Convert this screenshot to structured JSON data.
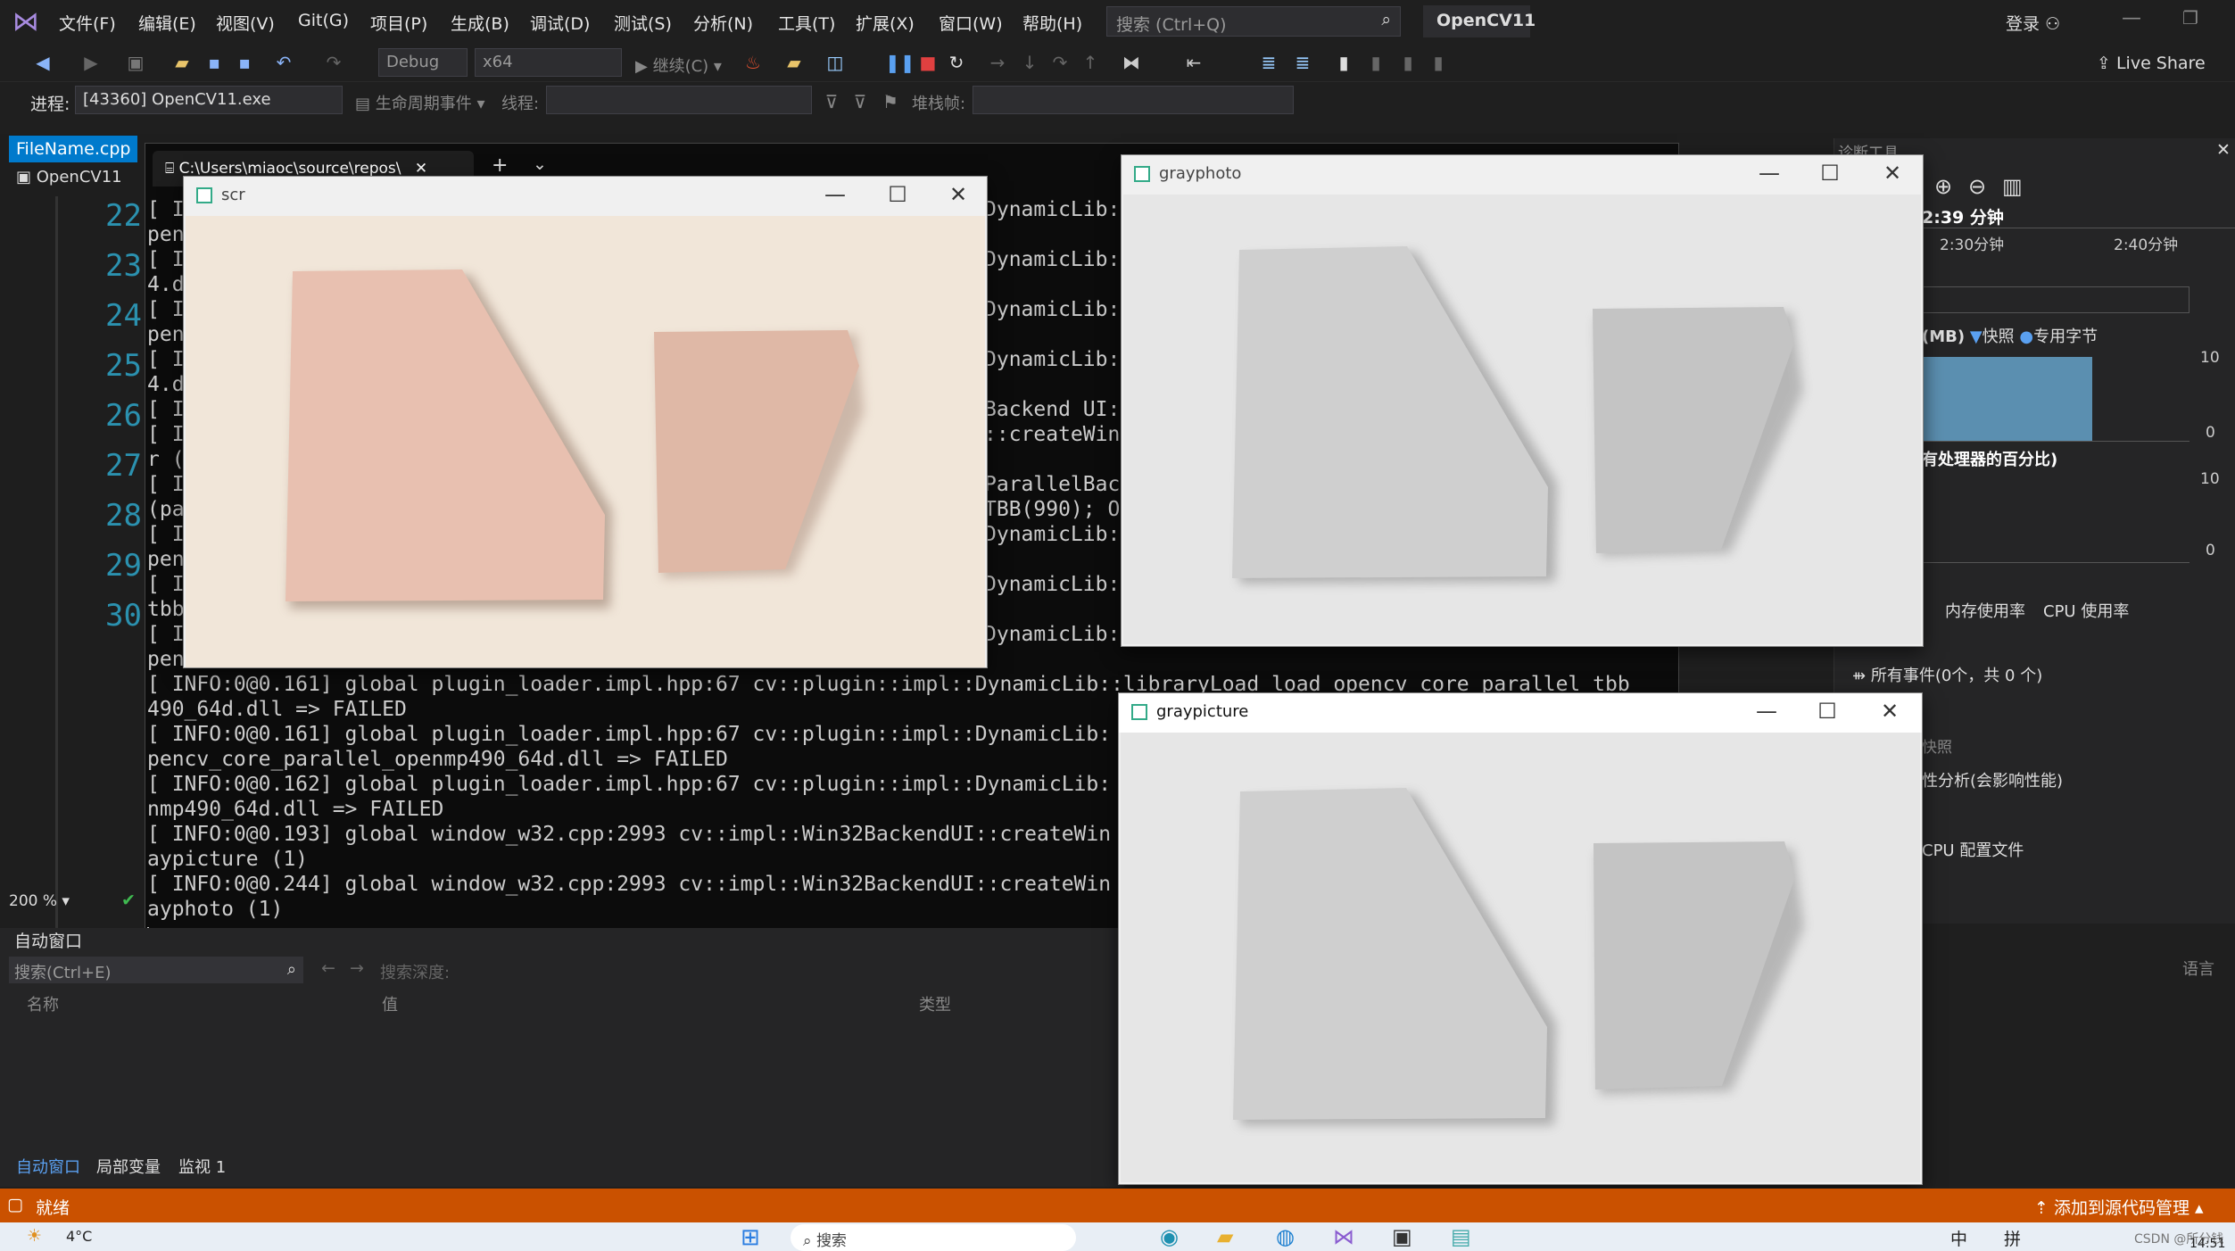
{
  "menu": [
    "文件(F)",
    "编辑(E)",
    "视图(V)",
    "Git(G)",
    "项目(P)",
    "生成(B)",
    "调试(D)",
    "测试(S)",
    "分析(N)",
    "工具(T)",
    "扩展(X)",
    "窗口(W)",
    "帮助(H)"
  ],
  "search_placeholder": "搜索 (Ctrl+Q)",
  "project_name": "OpenCV11",
  "login": "登录",
  "live_share": "Live Share",
  "toolbar": {
    "config": "Debug",
    "platform": "x64",
    "continue": "继续(C)"
  },
  "process": {
    "label": "进程:",
    "value": "[43360] OpenCV11.exe",
    "lifecycle": "生命周期事件",
    "thread_label": "线程:",
    "stack_label": "堆栈帧:"
  },
  "tabs": {
    "file": "FileName.cpp",
    "console": "C:\\Users\\miaoc\\source\\repos\\",
    "project": "OpenCV11"
  },
  "line_numbers": [
    "22",
    "23",
    "24",
    "25",
    "26",
    "27",
    "28",
    "29",
    "30"
  ],
  "zoom": "200 %",
  "console_lines": [
    "[ I",
    "pen",
    "[ I",
    "4.d",
    "[ I",
    "pen",
    "[ I",
    "4.d",
    "[ I",
    "[ I",
    "r (",
    "[ I",
    "(pa",
    "[ I",
    "pen",
    "[ I",
    "tbb",
    "[ I",
    "pen",
    "[ INFO:0@0.161] global plugin_loader.impl.hpp:67 cv::plugin::impl::DynamicLib::libraryLoad load opencv_core_parallel_tbb",
    "490_64d.dll => FAILED",
    "[ INFO:0@0.161] global plugin_loader.impl.hpp:67 cv::plugin::impl::DynamicLib:",
    "pencv_core_parallel_openmp490_64d.dll => FAILED",
    "[ INFO:0@0.162] global plugin_loader.impl.hpp:67 cv::plugin::impl::DynamicLib:",
    "nmp490_64d.dll => FAILED",
    "[ INFO:0@0.193] global window_w32.cpp:2993 cv::impl::Win32BackendUI::createWin",
    "aypicture (1)",
    "[ INFO:0@0.244] global window_w32.cpp:2993 cv::impl::Win32BackendUI::createWin",
    "ayphoto (1)"
  ],
  "console_right": [
    "DynamicLib:",
    "DynamicLib:",
    "DynamicLib:",
    "DynamicLib:",
    "Backend UI:",
    "::createWin",
    "ParallelBac",
    "TBB(990); O",
    "DynamicLib:",
    "DynamicLib:",
    "DynamicLib:"
  ],
  "windows": {
    "scr": "scr",
    "grayphoto": "grayphoto",
    "graypicture": "graypicture"
  },
  "diag": {
    "title": "诊断工具",
    "time": "2:39 分钟",
    "t1": "2:30分钟",
    "t2": "2:40分钟",
    "mem": "(MB)",
    "snap": "快照",
    "private": "专用字节",
    "y_top": "10",
    "y_zero": "0",
    "cpu": "有处理器的百分比)",
    "y2_top": "10",
    "y2_zero": "0",
    "tab_mem": "内存使用率",
    "tab_cpu": "CPU 使用率",
    "events": "所有事件(0个，共 0 个)",
    "snapshot": "快照",
    "analysis": "性分析(会影响性能)",
    "cpu_profile": "CPU 配置文件"
  },
  "auto": {
    "title": "自动窗口",
    "search": "搜索(Ctrl+E)",
    "depth": "搜索深度:",
    "col_name": "名称",
    "col_value": "值",
    "col_type": "类型",
    "lang": "语言",
    "tab1": "自动窗口",
    "tab2": "局部变量",
    "tab3": "监视 1"
  },
  "status": {
    "ready": "就绪",
    "source": "添加到源代码管理"
  },
  "taskbar": {
    "temp": "4°C",
    "search": "搜索",
    "ime1": "中",
    "ime2": "拼",
    "time": "14:51",
    "csdn": "CSDN @所分钱"
  }
}
